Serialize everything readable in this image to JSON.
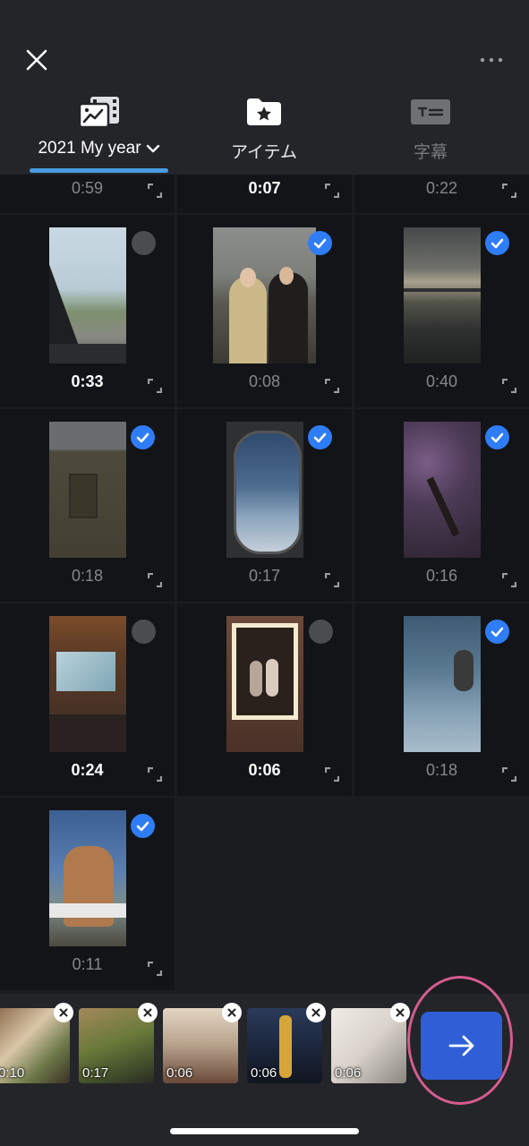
{
  "header": {
    "close_icon": "close-icon",
    "more_icon": "more-horizontal-icon",
    "tabs": [
      {
        "label": "2021 My year",
        "icon": "film-image-icon",
        "state": "active",
        "has_dropdown": true
      },
      {
        "label": "アイテム",
        "icon": "star-folder-icon",
        "state": "normal"
      },
      {
        "label": "字幕",
        "icon": "text-caption-icon",
        "state": "disabled"
      }
    ]
  },
  "grid": {
    "partial_row": [
      {
        "duration": "0:59",
        "emphasis": false
      },
      {
        "duration": "0:07",
        "emphasis": true
      },
      {
        "duration": "0:22",
        "emphasis": false
      }
    ],
    "items": [
      {
        "duration": "0:33",
        "selected": false,
        "emphasis": true
      },
      {
        "duration": "0:08",
        "selected": true,
        "emphasis": false
      },
      {
        "duration": "0:40",
        "selected": true,
        "emphasis": false
      },
      {
        "duration": "0:18",
        "selected": true,
        "emphasis": false
      },
      {
        "duration": "0:17",
        "selected": true,
        "emphasis": false
      },
      {
        "duration": "0:16",
        "selected": true,
        "emphasis": false
      },
      {
        "duration": "0:24",
        "selected": false,
        "emphasis": true
      },
      {
        "duration": "0:06",
        "selected": false,
        "emphasis": true
      },
      {
        "duration": "0:18",
        "selected": true,
        "emphasis": false
      },
      {
        "duration": "0:11",
        "selected": true,
        "emphasis": false
      }
    ]
  },
  "tray": {
    "items": [
      {
        "duration": "0:10"
      },
      {
        "duration": "0:17"
      },
      {
        "duration": "0:06"
      },
      {
        "duration": "0:06"
      },
      {
        "duration": "0:06"
      }
    ],
    "next_icon": "arrow-right-icon"
  },
  "colors": {
    "accent": "#2f7df6",
    "next_button": "#2f5ed6",
    "tab_underline": "#4a9be0",
    "highlight_ring": "#d45c8e"
  }
}
